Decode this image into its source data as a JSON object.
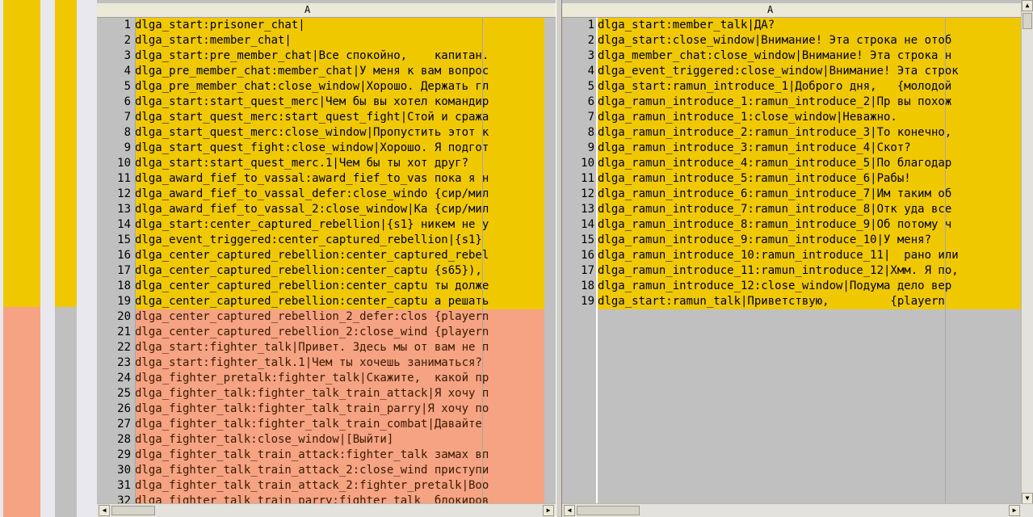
{
  "colors": {
    "equal": "#f5dfa0",
    "changed": "#f0c800",
    "removed": "#f5a383",
    "empty": "#c0c0c0"
  },
  "left_pane": {
    "column_label": "A",
    "rows": [
      {
        "num": "1",
        "text": "dlga_start:prisoner_chat|",
        "status": "changed"
      },
      {
        "num": "2",
        "text": "dlga_start:member_chat|",
        "status": "changed"
      },
      {
        "num": "3",
        "text": "dlga_start:pre_member_chat|Все спокойно,    капитан.",
        "status": "changed"
      },
      {
        "num": "4",
        "text": "dlga_pre_member_chat:member_chat|У меня к вам вопрос",
        "status": "changed"
      },
      {
        "num": "5",
        "text": "dlga_pre_member_chat:close_window|Хорошо. Держать гл",
        "status": "changed"
      },
      {
        "num": "6",
        "text": "dlga_start:start_quest_merc|Чем бы вы хотел командир",
        "status": "changed"
      },
      {
        "num": "7",
        "text": "dlga_start_quest_merc:start_quest_fight|Стой и сража",
        "status": "changed"
      },
      {
        "num": "8",
        "text": "dlga_start_quest_merc:close_window|Пропустить этот к",
        "status": "changed"
      },
      {
        "num": "9",
        "text": "dlga_start_quest_fight:close_window|Хорошо. Я подгот",
        "status": "changed"
      },
      {
        "num": "10",
        "text": "dlga_start:start_quest_merc.1|Чем бы ты хот друг?",
        "status": "changed"
      },
      {
        "num": "11",
        "text": "dlga_award_fief_to_vassal:award_fief_to_vas пока я н",
        "status": "changed"
      },
      {
        "num": "12",
        "text": "dlga_award_fief_to_vassal_defer:close_windo {сир/мил",
        "status": "changed"
      },
      {
        "num": "13",
        "text": "dlga_award_fief_to_vassal_2:close_window|Ка {сир/мил",
        "status": "changed"
      },
      {
        "num": "14",
        "text": "dlga_start:center_captured_rebellion|{s1} никем не у",
        "status": "changed"
      },
      {
        "num": "15",
        "text": "dlga_event_triggered:center_captured_rebellion|{s1}",
        "status": "changed"
      },
      {
        "num": "16",
        "text": "dlga_center_captured_rebellion:center_captured_rebel",
        "status": "changed"
      },
      {
        "num": "17",
        "text": "dlga_center_captured_rebellion:center_captu {s65}),",
        "status": "changed"
      },
      {
        "num": "18",
        "text": "dlga_center_captured_rebellion:center_captu ты долже",
        "status": "changed"
      },
      {
        "num": "19",
        "text": "dlga_center_captured_rebellion:center_captu а решать",
        "status": "changed"
      },
      {
        "num": "20",
        "text": "dlga_center_captured_rebellion_2_defer:clos {playern",
        "status": "removed"
      },
      {
        "num": "21",
        "text": "dlga_center_captured_rebellion_2:close_wind {playern",
        "status": "removed"
      },
      {
        "num": "22",
        "text": "dlga_start:fighter_talk|Привет. Здесь мы от вам не п",
        "status": "removed"
      },
      {
        "num": "23",
        "text": "dlga_start:fighter_talk.1|Чем ты хочешь заниматься?",
        "status": "removed"
      },
      {
        "num": "24",
        "text": "dlga_fighter_pretalk:fighter_talk|Скажите,  какой пр",
        "status": "removed"
      },
      {
        "num": "25",
        "text": "dlga_fighter_talk:fighter_talk_train_attack|Я хочу п",
        "status": "removed"
      },
      {
        "num": "26",
        "text": "dlga_fighter_talk:fighter_talk_train_parry|Я хочу по",
        "status": "removed"
      },
      {
        "num": "27",
        "text": "dlga_fighter_talk:fighter_talk_train_combat|Давайте",
        "status": "removed"
      },
      {
        "num": "28",
        "text": "dlga_fighter_talk:close_window|[Выйти]",
        "status": "removed"
      },
      {
        "num": "29",
        "text": "dlga_fighter_talk_train_attack:fighter_talk замах вп",
        "status": "removed"
      },
      {
        "num": "30",
        "text": "dlga_fighter_talk_train_attack_2:close_wind приступи",
        "status": "removed"
      },
      {
        "num": "31",
        "text": "dlga_fighter_talk_train_attack_2:fighter_pretalk|Boo",
        "status": "removed"
      },
      {
        "num": "32",
        "text": "dlga_fighter_talk_train_parry:fighter_talk  блокиров",
        "status": "removed"
      }
    ]
  },
  "right_pane": {
    "column_label": "A",
    "rows": [
      {
        "num": "1",
        "text": "dlga_start:member_talk|ДА?",
        "status": "changed"
      },
      {
        "num": "2",
        "text": "dlga_start:close_window|Внимание! Эта строка не отоб",
        "status": "changed"
      },
      {
        "num": "3",
        "text": "dlga_member_chat:close_window|Внимание! Эта строка н",
        "status": "changed"
      },
      {
        "num": "4",
        "text": "dlga_event_triggered:close_window|Внимание! Эта строк",
        "status": "changed"
      },
      {
        "num": "5",
        "text": "dlga_start:ramun_introduce_1|Доброго дня,   {молодой",
        "status": "changed"
      },
      {
        "num": "6",
        "text": "dlga_ramun_introduce_1:ramun_introduce_2|Пр вы похож",
        "status": "changed"
      },
      {
        "num": "7",
        "text": "dlga_ramun_introduce_1:close_window|Неважно.",
        "status": "changed"
      },
      {
        "num": "8",
        "text": "dlga_ramun_introduce_2:ramun_introduce_3|То конечно,",
        "status": "changed"
      },
      {
        "num": "9",
        "text": "dlga_ramun_introduce_3:ramun_introduce_4|Скот?",
        "status": "changed"
      },
      {
        "num": "10",
        "text": "dlga_ramun_introduce_4:ramun_introduce_5|По благодар",
        "status": "changed"
      },
      {
        "num": "11",
        "text": "dlga_ramun_introduce_5:ramun_introduce_6|Рабы!",
        "status": "changed"
      },
      {
        "num": "12",
        "text": "dlga_ramun_introduce_6:ramun_introduce_7|Им таким об",
        "status": "changed"
      },
      {
        "num": "13",
        "text": "dlga_ramun_introduce_7:ramun_introduce_8|Отк уда все",
        "status": "changed"
      },
      {
        "num": "14",
        "text": "dlga_ramun_introduce_8:ramun_introduce_9|Об потому ч",
        "status": "changed"
      },
      {
        "num": "15",
        "text": "dlga_ramun_introduce_9:ramun_introduce_10|У меня?",
        "status": "changed"
      },
      {
        "num": "16",
        "text": "dlga_ramun_introduce_10:ramun_introduce_11|  рано или",
        "status": "changed"
      },
      {
        "num": "17",
        "text": "dlga_ramun_introduce_11:ramun_introduce_12|Хмм. Я по,",
        "status": "changed"
      },
      {
        "num": "18",
        "text": "dlga_ramun_introduce_12:close_window|Подума дело вер",
        "status": "changed"
      },
      {
        "num": "19",
        "text": "dlga_start:ramun_talk|Приветствую,         {playern",
        "status": "changed"
      }
    ]
  }
}
